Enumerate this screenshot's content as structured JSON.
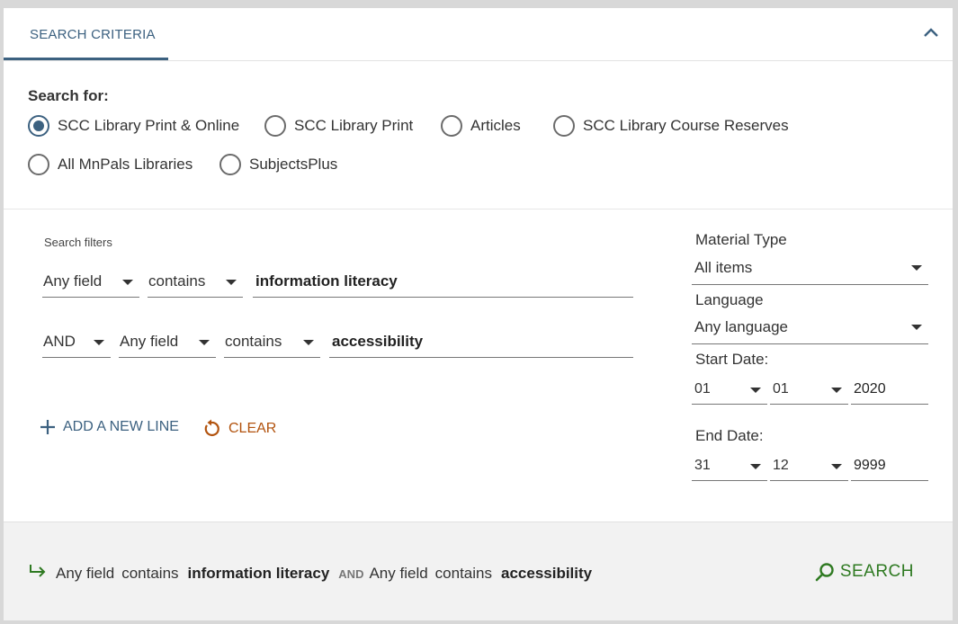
{
  "header": {
    "tab_label": "SEARCH CRITERIA"
  },
  "scopes": {
    "label": "Search for:",
    "options": [
      {
        "label": "SCC Library Print & Online",
        "selected": true
      },
      {
        "label": "SCC Library Print",
        "selected": false
      },
      {
        "label": "Articles",
        "selected": false
      },
      {
        "label": "SCC Library Course Reserves",
        "selected": false
      },
      {
        "label": "All MnPals Libraries",
        "selected": false
      },
      {
        "label": "SubjectsPlus",
        "selected": false
      }
    ]
  },
  "filters": {
    "label": "Search filters",
    "lines": [
      {
        "field": "Any field",
        "precision": "contains",
        "value": "information literacy"
      },
      {
        "operator": "AND",
        "field": "Any field",
        "precision": "contains",
        "value": "accessibility"
      }
    ],
    "add_line_label": "ADD A NEW LINE",
    "clear_label": "CLEAR"
  },
  "facets": {
    "material_type_label": "Material Type",
    "material_type_value": "All items",
    "language_label": "Language",
    "language_value": "Any language",
    "start_date_label": "Start Date:",
    "start_day": "01",
    "start_month": "01",
    "start_year": "2020",
    "end_date_label": "End Date:",
    "end_day": "31",
    "end_month": "12",
    "end_year": "9999"
  },
  "footer": {
    "line1_field": "Any field",
    "line1_precision": "contains",
    "line1_value": "information literacy",
    "operator": "AND",
    "line2_field": "Any field",
    "line2_precision": "contains",
    "line2_value": "accessibility",
    "search_label": "SEARCH"
  },
  "colors": {
    "accent": "#3c6180",
    "clear": "#b2530e",
    "search": "#2f7a22",
    "footer_bg": "#f2f2f2"
  }
}
